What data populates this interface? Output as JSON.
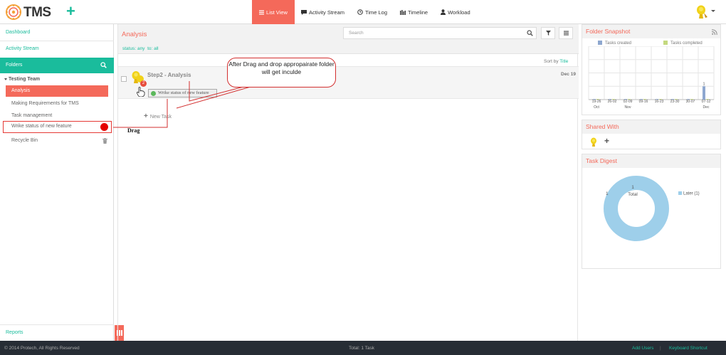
{
  "app": {
    "name": "TMS"
  },
  "nav": {
    "tabs": [
      {
        "label": "List View",
        "icon": "list-icon",
        "active": true
      },
      {
        "label": "Activity Stream",
        "icon": "comment-icon"
      },
      {
        "label": "Time Log",
        "icon": "clock-icon"
      },
      {
        "label": "Timeline",
        "icon": "timeline-icon"
      },
      {
        "label": "Workload",
        "icon": "user-icon"
      }
    ]
  },
  "sidebar": {
    "dashboard": "Dashboard",
    "activity_stream": "Activity Stream",
    "folders": "Folders",
    "team": "Testing Team",
    "items": [
      "Analysis",
      "Making Requirements for TMS",
      "Task management",
      "Wrike status of new feature"
    ],
    "recycle_bin": "Recycle Bin",
    "reports": "Reports"
  },
  "main": {
    "title": "Analysis",
    "filter_status": "status: any",
    "filter_to": "to: all",
    "search_placeholder": "Search",
    "sort_prefix": "Sort by",
    "sort_field": "Title",
    "task": {
      "title": "Step2 - Analysis",
      "date": "Dec 19",
      "badge": "2"
    },
    "drag_chip": "Wrike status of new feature",
    "new_task": "New Task",
    "drag_label": "Drag",
    "callout": "After Drag and drop appropairate folder will get inculde"
  },
  "snapshot": {
    "title": "Folder Snapshot",
    "legend_created": "Tasks created",
    "legend_completed": "Tasks completed"
  },
  "chart_data": {
    "type": "bar",
    "categories": [
      "19-26",
      "26-02",
      "02-09",
      "09-16",
      "16-23",
      "23-30",
      "30-07",
      "07-12"
    ],
    "month_labels": [
      "Oct",
      "",
      "Nov",
      "",
      "",
      "",
      "",
      "Dec"
    ],
    "series": [
      {
        "name": "Tasks created",
        "values": [
          0,
          0,
          0,
          0,
          0,
          0,
          0,
          1
        ],
        "color": "#8ea7cf"
      },
      {
        "name": "Tasks completed",
        "values": [
          0,
          0,
          0,
          0,
          0,
          0,
          0,
          0
        ],
        "color": "#c4d97f"
      }
    ],
    "data_labels": [
      "",
      "",
      "",
      "",
      "",
      "",
      "",
      "1"
    ],
    "ylim": [
      0,
      4
    ]
  },
  "shared": {
    "title": "Shared With"
  },
  "digest": {
    "title": "Task Digest",
    "total_value": "1",
    "total_label": "Total",
    "segment_value": "1",
    "legend": "Later (1)",
    "color": "#9ecfea"
  },
  "footer": {
    "copyright": "© 2014 Protech, All Rights Reserved",
    "total": "Total: 1 Task",
    "add_users": "Add Users",
    "separator": "|",
    "keyboard": "Keyboard Shortcut"
  },
  "colors": {
    "accent": "#f4695a",
    "teal": "#1abc9c",
    "footer": "#272d35"
  }
}
